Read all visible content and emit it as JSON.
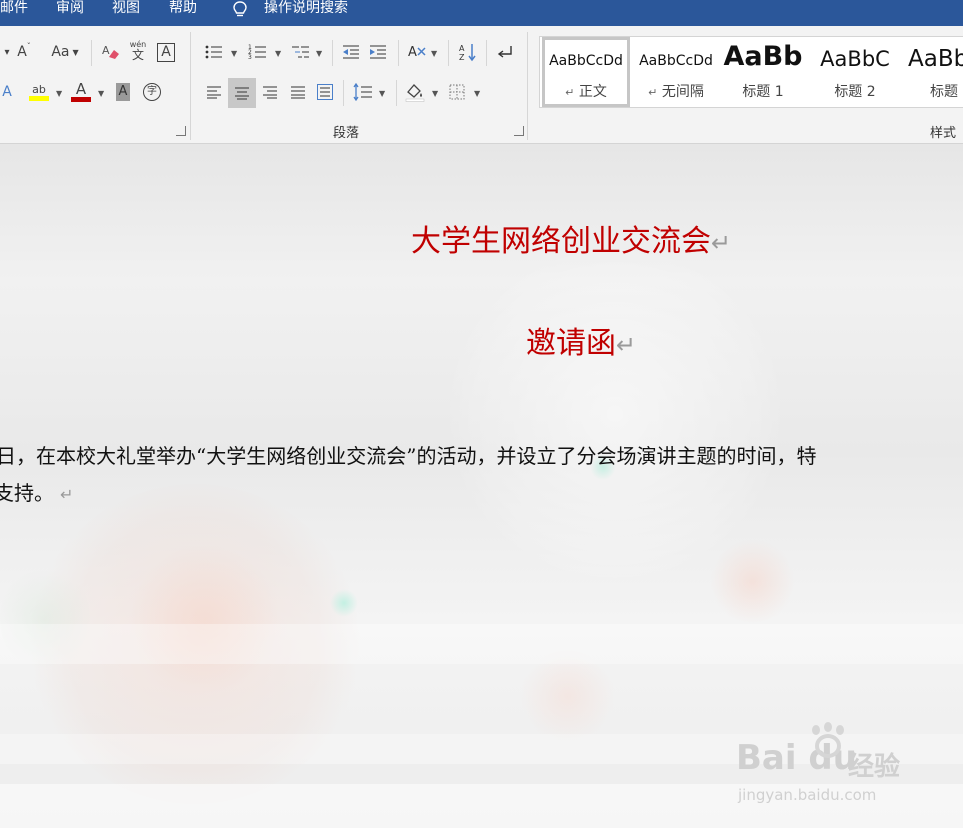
{
  "menu": {
    "items": [
      "邮件",
      "审阅",
      "视图",
      "帮助"
    ],
    "search_label": "操作说明搜索"
  },
  "ribbon": {
    "font": {
      "grow_font": "A",
      "case_button": "Aa",
      "phonetic_top": "wén",
      "phonetic_bottom": "文",
      "border_char": "A",
      "highlight_text": "ab",
      "font_color": "A",
      "char_shading": "A",
      "enclose_char": "字"
    },
    "paragraph": {
      "label": "段落"
    },
    "styles": {
      "label": "样式",
      "items": [
        {
          "preview": "AaBbCcDd",
          "name": "正文",
          "mark": "↵"
        },
        {
          "preview": "AaBbCcDd",
          "name": "无间隔",
          "mark": "↵"
        },
        {
          "preview": "AaBb",
          "name": "标题 1"
        },
        {
          "preview": "AaBbC",
          "name": "标题 2"
        },
        {
          "preview": "AaBb",
          "name": "标题"
        }
      ]
    }
  },
  "document": {
    "title": "大学生网络创业交流会",
    "subtitle": "邀请函",
    "para_mark": "↵",
    "body_line1": "日，在本校大礼堂举办“大学生网络创业交流会”的活动，并设立了分会场演讲主题的时间，特",
    "body_line2": "支持。"
  },
  "watermark": {
    "brand": "Bai du",
    "jingyan": "经验",
    "url": "jingyan.baidu.com"
  },
  "colors": {
    "menubar": "#2b579a",
    "title_red": "#c00000",
    "highlight_yellow": "#ffff00",
    "font_red": "#c00000"
  }
}
